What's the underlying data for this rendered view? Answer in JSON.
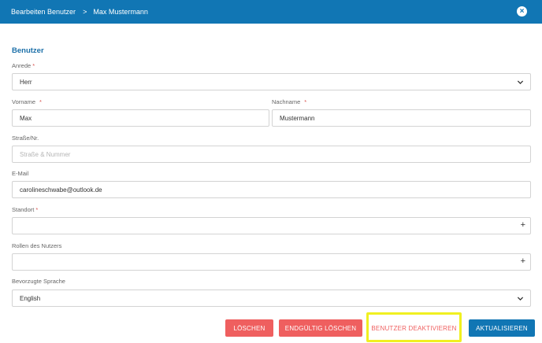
{
  "header": {
    "breadcrumb_parent": "Bearbeiten Benutzer",
    "breadcrumb_sep": ">",
    "breadcrumb_current": "Max Mustermann",
    "close_icon": "close-icon"
  },
  "section": {
    "title": "Benutzer"
  },
  "form": {
    "anrede": {
      "label": "Anrede",
      "required": "*",
      "value": "Herr"
    },
    "vorname": {
      "label": "Vorname",
      "required": "*",
      "value": "Max"
    },
    "nachname": {
      "label": "Nachname",
      "required": "*",
      "value": "Mustermann"
    },
    "strasse": {
      "label": "Straße/Nr.",
      "placeholder": "Straße & Nummer"
    },
    "email": {
      "label": "E-Mail",
      "value": "carolineschwabe@outlook.de"
    },
    "standort": {
      "label": "Standort",
      "required": "*",
      "value": ""
    },
    "rollen": {
      "label": "Rollen des Nutzers",
      "value": ""
    },
    "sprache": {
      "label": "Bevorzugte Sprache",
      "value": "English"
    }
  },
  "actions": {
    "loeschen": "LÖSCHEN",
    "endgueltig_loeschen": "ENDGÜLTIG LÖSCHEN",
    "deaktivieren": "BENUTZER DEAKTIVIEREN",
    "aktualisieren": "AKTUALISIEREN"
  },
  "colors": {
    "primary": "#1176b4",
    "danger": "#ef5f5f",
    "highlight": "#f0f020"
  }
}
